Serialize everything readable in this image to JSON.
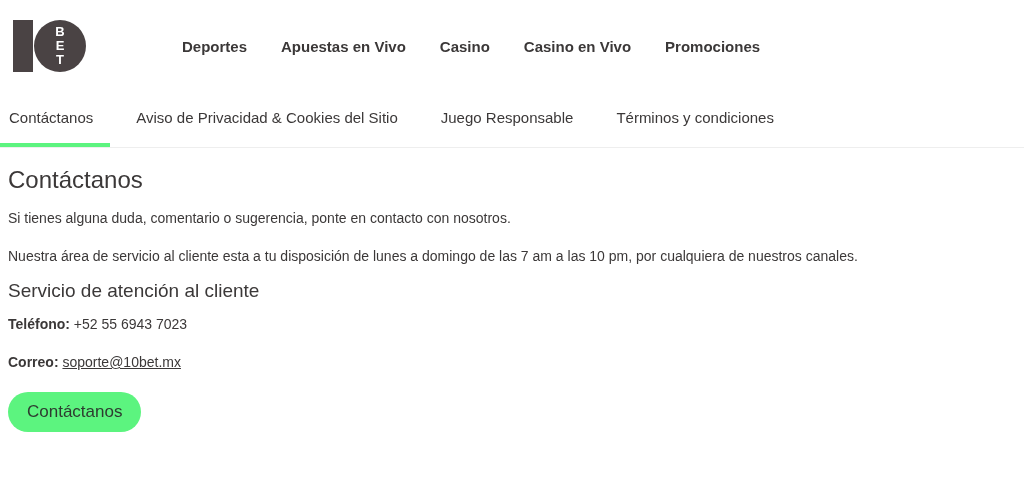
{
  "logo": {
    "text": "BET"
  },
  "nav": [
    "Deportes",
    "Apuestas en Vivo",
    "Casino",
    "Casino en Vivo",
    "Promociones"
  ],
  "tabs": [
    {
      "label": "Contáctanos",
      "selected": true
    },
    {
      "label": "Aviso de Privacidad & Cookies del Sitio",
      "selected": false
    },
    {
      "label": "Juego Responsable",
      "selected": false
    },
    {
      "label": "Términos y condiciones",
      "selected": false
    }
  ],
  "title": "Contáctanos",
  "paragraphs": [
    "Si tienes alguna duda, comentario o sugerencia, ponte en contacto con nosotros.",
    "Nuestra área de servicio al cliente esta a tu disposición de lunes a domingo de las 7 am a las 10 pm, por cualquiera de nuestros canales."
  ],
  "subtitle": "Servicio de atención al cliente",
  "phone": {
    "label": "Teléfono:",
    "value": "+52 55 6943 7023"
  },
  "email": {
    "label": "Correo:",
    "value": "soporte@10bet.mx"
  },
  "button": "Contáctanos"
}
